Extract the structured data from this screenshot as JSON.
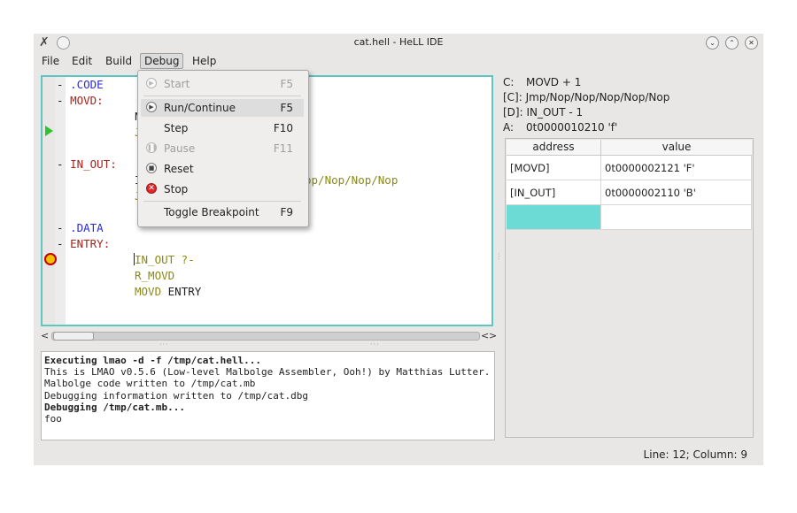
{
  "window": {
    "title": "cat.hell - HeLL IDE",
    "app_icon": "tools-icon",
    "controls": [
      "minimize-icon",
      "maximize-icon",
      "close-icon"
    ]
  },
  "menubar": [
    "File",
    "Edit",
    "Build",
    "Debug",
    "Help"
  ],
  "editor": {
    "lines": [
      {
        "prefix": "- ",
        "text": ".CODE",
        "color": "blue"
      },
      {
        "prefix": "- ",
        "text": "MOVD:",
        "color": "red"
      },
      {
        "prefix": "",
        "text": "N",
        "color": "dark"
      },
      {
        "prefix": "",
        "text": "J",
        "color": "olive"
      },
      {
        "prefix": "- ",
        "text": "IN_OUT:",
        "color": "red"
      },
      {
        "prefix": "",
        "text": "I",
        "color": "dark"
      },
      {
        "prefix": "",
        "text": "op/Nop/Nop/Nop",
        "color": "olive"
      },
      {
        "prefix": "",
        "text": "J",
        "color": "olive"
      },
      {
        "prefix": "- ",
        "text": ".DATA",
        "color": "blue"
      },
      {
        "prefix": "- ",
        "text": "ENTRY:",
        "color": "red"
      },
      {
        "prefix": "",
        "text": "IN_OUT ?-",
        "color": "olive"
      },
      {
        "prefix": "",
        "text": "R_MOVD",
        "color": "olive"
      },
      {
        "prefix": "",
        "text": "MOVD ",
        "color": "olive"
      },
      {
        "prefix": "",
        "text": "ENTRY",
        "color": "dark"
      }
    ]
  },
  "output": {
    "lines": [
      {
        "text": "Executing lmao -d -f /tmp/cat.hell...",
        "bold": true
      },
      {
        "text": "This is LMAO v0.5.6 (Low-level Malbolge Assembler, Ooh!) by Matthias Lutter.",
        "bold": false
      },
      {
        "text": "Malbolge code written to /tmp/cat.mb",
        "bold": false
      },
      {
        "text": "Debugging information written to /tmp/cat.dbg",
        "bold": false
      },
      {
        "text": "Debugging /tmp/cat.mb...",
        "bold": true
      },
      {
        "text": "foo",
        "bold": false
      }
    ]
  },
  "registers": {
    "c_key": "C:",
    "c_val": "MOVD + 1",
    "c_bracket": "[C]: Jmp/Nop/Nop/Nop/Nop/Nop",
    "d_bracket": "[D]: IN_OUT - 1",
    "a_key": "A:",
    "a_val": "0t0000010210 'f'"
  },
  "memory": {
    "headers": [
      "address",
      "value"
    ],
    "rows": [
      {
        "address": "[MOVD]",
        "value": "0t0000002121 'F'"
      },
      {
        "address": "[IN_OUT]",
        "value": "0t0000002110 'B'"
      },
      {
        "address": "",
        "value": ""
      }
    ]
  },
  "status": {
    "position": "Line: 12; Column: 9"
  },
  "debug_menu": {
    "items": [
      {
        "label": "Start",
        "shortcut": "F5",
        "icon": "play-icon",
        "disabled": true,
        "hover": false
      },
      {
        "label": "Run/Continue",
        "shortcut": "F5",
        "icon": "play-icon",
        "disabled": false,
        "hover": true
      },
      {
        "label": "Step",
        "shortcut": "F10",
        "icon": "",
        "disabled": false,
        "hover": false
      },
      {
        "label": "Pause",
        "shortcut": "F11",
        "icon": "pause-icon",
        "disabled": true,
        "hover": false
      },
      {
        "label": "Reset",
        "shortcut": "",
        "icon": "stop-square-icon",
        "disabled": false,
        "hover": false
      },
      {
        "label": "Stop",
        "shortcut": "",
        "icon": "stop-icon",
        "disabled": false,
        "hover": false
      },
      {
        "label": "Toggle Breakpoint",
        "shortcut": "F9",
        "icon": "",
        "disabled": false,
        "hover": false
      }
    ]
  }
}
